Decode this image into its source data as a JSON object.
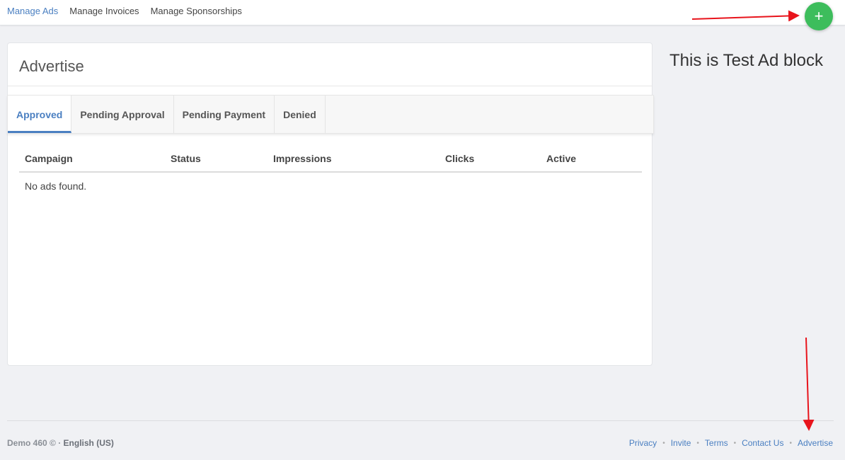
{
  "topnav": {
    "items": [
      {
        "label": "Manage Ads",
        "active": true
      },
      {
        "label": "Manage Invoices",
        "active": false
      },
      {
        "label": "Manage Sponsorships",
        "active": false
      }
    ],
    "fab_icon": "plus-icon",
    "fab_symbol": "+",
    "fab_color": "#3dbd5c"
  },
  "card": {
    "title": "Advertise",
    "tabs": [
      {
        "label": "Approved",
        "active": true
      },
      {
        "label": "Pending Approval",
        "active": false
      },
      {
        "label": "Pending Payment",
        "active": false
      },
      {
        "label": "Denied",
        "active": false
      }
    ],
    "table": {
      "columns": [
        "Campaign",
        "Status",
        "Impressions",
        "Clicks",
        "Active"
      ],
      "empty_message": "No ads found."
    }
  },
  "adblock": {
    "text": "This is Test Ad block"
  },
  "footer": {
    "site": "Demo 460 © ·",
    "language": "English (US)",
    "links": [
      "Privacy",
      "Invite",
      "Terms",
      "Contact Us",
      "Advertise"
    ],
    "separator": "•"
  },
  "colors": {
    "accent": "#4a7fc1",
    "annotation": "#e8141c"
  }
}
